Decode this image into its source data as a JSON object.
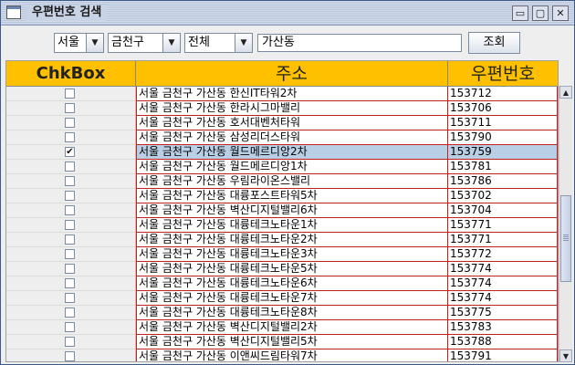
{
  "window": {
    "title": "우편번호 검색",
    "controls": {
      "minimize": "▭",
      "maximize": "▢",
      "close": "✕"
    }
  },
  "toolbar": {
    "city": "서울",
    "district": "금천구",
    "scope": "전체",
    "search_value": "가산동",
    "search_button": "조회"
  },
  "table": {
    "headers": {
      "chk": "ChkBox",
      "address": "주소",
      "zip": "우편번호"
    },
    "header_color": "#ffc000",
    "rows": [
      {
        "checked": false,
        "address": "서울 금천구 가산동 한신IT타워2차",
        "zip": "153712"
      },
      {
        "checked": false,
        "address": "서울 금천구 가산동 한라시그마밸리",
        "zip": "153706"
      },
      {
        "checked": false,
        "address": "서울 금천구 가산동 호서대벤처타워",
        "zip": "153711"
      },
      {
        "checked": false,
        "address": "서울 금천구 가산동 삼성리더스타워",
        "zip": "153790"
      },
      {
        "checked": true,
        "address": "서울 금천구 가산동 월드메르디앙2차",
        "zip": "153759"
      },
      {
        "checked": false,
        "address": "서울 금천구 가산동 월드메르디앙1차",
        "zip": "153781"
      },
      {
        "checked": false,
        "address": "서울 금천구 가산동 우림라이온스밸리",
        "zip": "153786"
      },
      {
        "checked": false,
        "address": "서울 금천구 가산동 대륭포스트타워5차",
        "zip": "153702"
      },
      {
        "checked": false,
        "address": "서울 금천구 가산동 벽산디지털밸리6차",
        "zip": "153704"
      },
      {
        "checked": false,
        "address": "서울 금천구 가산동 대륭테크노타운1차",
        "zip": "153771"
      },
      {
        "checked": false,
        "address": "서울 금천구 가산동 대륭테크노타운2차",
        "zip": "153771"
      },
      {
        "checked": false,
        "address": "서울 금천구 가산동 대륭테크노타운3차",
        "zip": "153772"
      },
      {
        "checked": false,
        "address": "서울 금천구 가산동 대륭테크노타운5차",
        "zip": "153774"
      },
      {
        "checked": false,
        "address": "서울 금천구 가산동 대륭테크노타운6차",
        "zip": "153774"
      },
      {
        "checked": false,
        "address": "서울 금천구 가산동 대륭테크노타운7차",
        "zip": "153774"
      },
      {
        "checked": false,
        "address": "서울 금천구 가산동 대륭테크노타운8차",
        "zip": "153775"
      },
      {
        "checked": false,
        "address": "서울 금천구 가산동 벽산디지털밸리2차",
        "zip": "153783"
      },
      {
        "checked": false,
        "address": "서울 금천구 가산동 벽산디지털밸리5차",
        "zip": "153788"
      },
      {
        "checked": false,
        "address": "서울 금천구 가산동 이앤씨드림타워7차",
        "zip": "153791"
      }
    ]
  },
  "scrollbar": {
    "up_icon": "▲",
    "down_icon": "▼"
  }
}
